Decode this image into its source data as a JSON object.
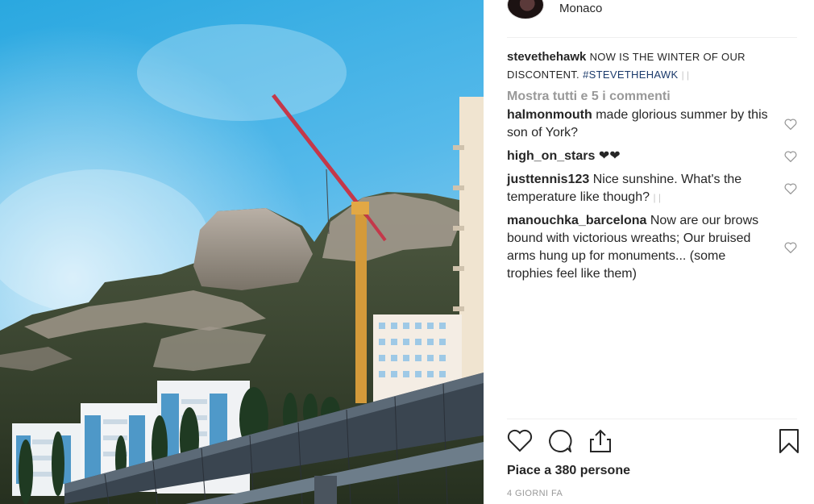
{
  "post": {
    "location": "Monaco",
    "caption": {
      "username": "stevethehawk",
      "text": "NOW IS THE WINTER OF OUR DISCONTENT.",
      "hashtag": "#STEVETHEHAWK",
      "tail": "| |"
    },
    "show_all_comments": "Mostra tutti e 5 i commenti",
    "comments": [
      {
        "username": "halmonmouth",
        "text": "made glorious summer by this son of York?"
      },
      {
        "username": "high_on_stars",
        "text": "❤‍❤"
      },
      {
        "username": "justtennis123",
        "text": "Nice sunshine. What's the temperature like though?",
        "tail": "| |"
      },
      {
        "username": "manouchka_barcelona",
        "text": "Now are our brows bound with victorious wreaths; Our bruised arms hung up for monuments... (some trophies feel like them)"
      }
    ],
    "likes_text": "Piace a 380 persone",
    "time_text": "4 GIORNI FA"
  },
  "icons": {
    "like": "heart-icon",
    "comment": "comment-icon",
    "share": "share-icon",
    "save": "bookmark-icon",
    "comment_like": "heart-icon"
  },
  "colors": {
    "text": "#262626",
    "muted": "#999999",
    "hashtag": "#1b3a6b",
    "divider": "#efefef"
  }
}
